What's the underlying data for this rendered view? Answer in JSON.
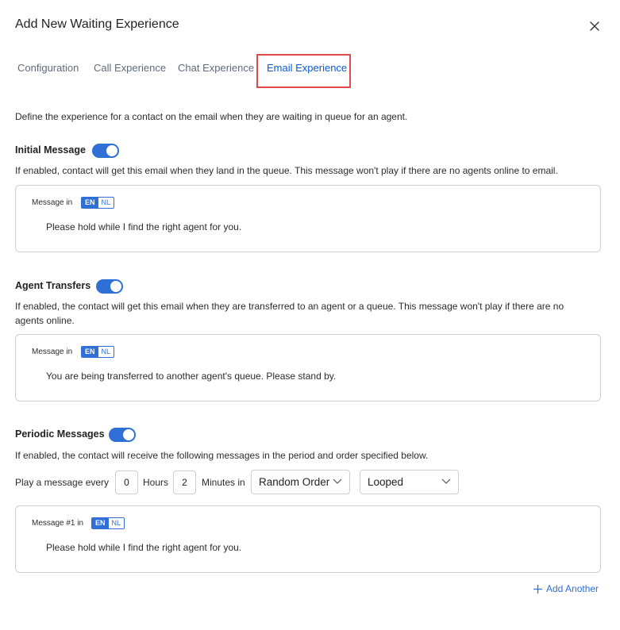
{
  "dialog": {
    "title": "Add New Waiting Experience"
  },
  "tabs": [
    {
      "label": "Configuration"
    },
    {
      "label": "Call Experience"
    },
    {
      "label": "Chat Experience"
    },
    {
      "label": "Email Experience",
      "active": true
    }
  ],
  "intro": "Define the experience for a contact on the email when they are waiting in queue for an agent.",
  "initial": {
    "label": "Initial Message",
    "enabled": true,
    "description": "If enabled, contact will get this email when they land in the queue. This message won't play if there are no agents online to email.",
    "message_label": "Message in",
    "languages": [
      "EN",
      "NL"
    ],
    "selected_language": "EN",
    "message": "Please hold while I find the right agent for you."
  },
  "transfers": {
    "label": "Agent Transfers",
    "enabled": true,
    "description_line1": "If enabled, the contact will get this email when they are transferred to an agent or a queue. This message won't play if there are no",
    "description_line2": "agents online.",
    "message_label": "Message in",
    "languages": [
      "EN",
      "NL"
    ],
    "selected_language": "EN",
    "message": "You are being transferred to another agent's queue. Please stand by."
  },
  "periodic": {
    "label": "Periodic Messages",
    "enabled": true,
    "description": "If enabled, the contact will receive the following messages in the period and order specified below.",
    "play_prefix": "Play a message every",
    "hours_value": "0",
    "hours_label": "Hours",
    "minutes_value": "2",
    "minutes_label": "Minutes in",
    "order_select": "Random Order",
    "loop_select": "Looped",
    "message_label": "Message #1 in",
    "languages": [
      "EN",
      "NL"
    ],
    "selected_language": "EN",
    "message": "Please hold while I find the right agent for you.",
    "add_label": "Add Another"
  },
  "colors": {
    "accent": "#2f6fd6",
    "active_tab": "#0b5cd5",
    "highlight": "#e04a4a"
  }
}
